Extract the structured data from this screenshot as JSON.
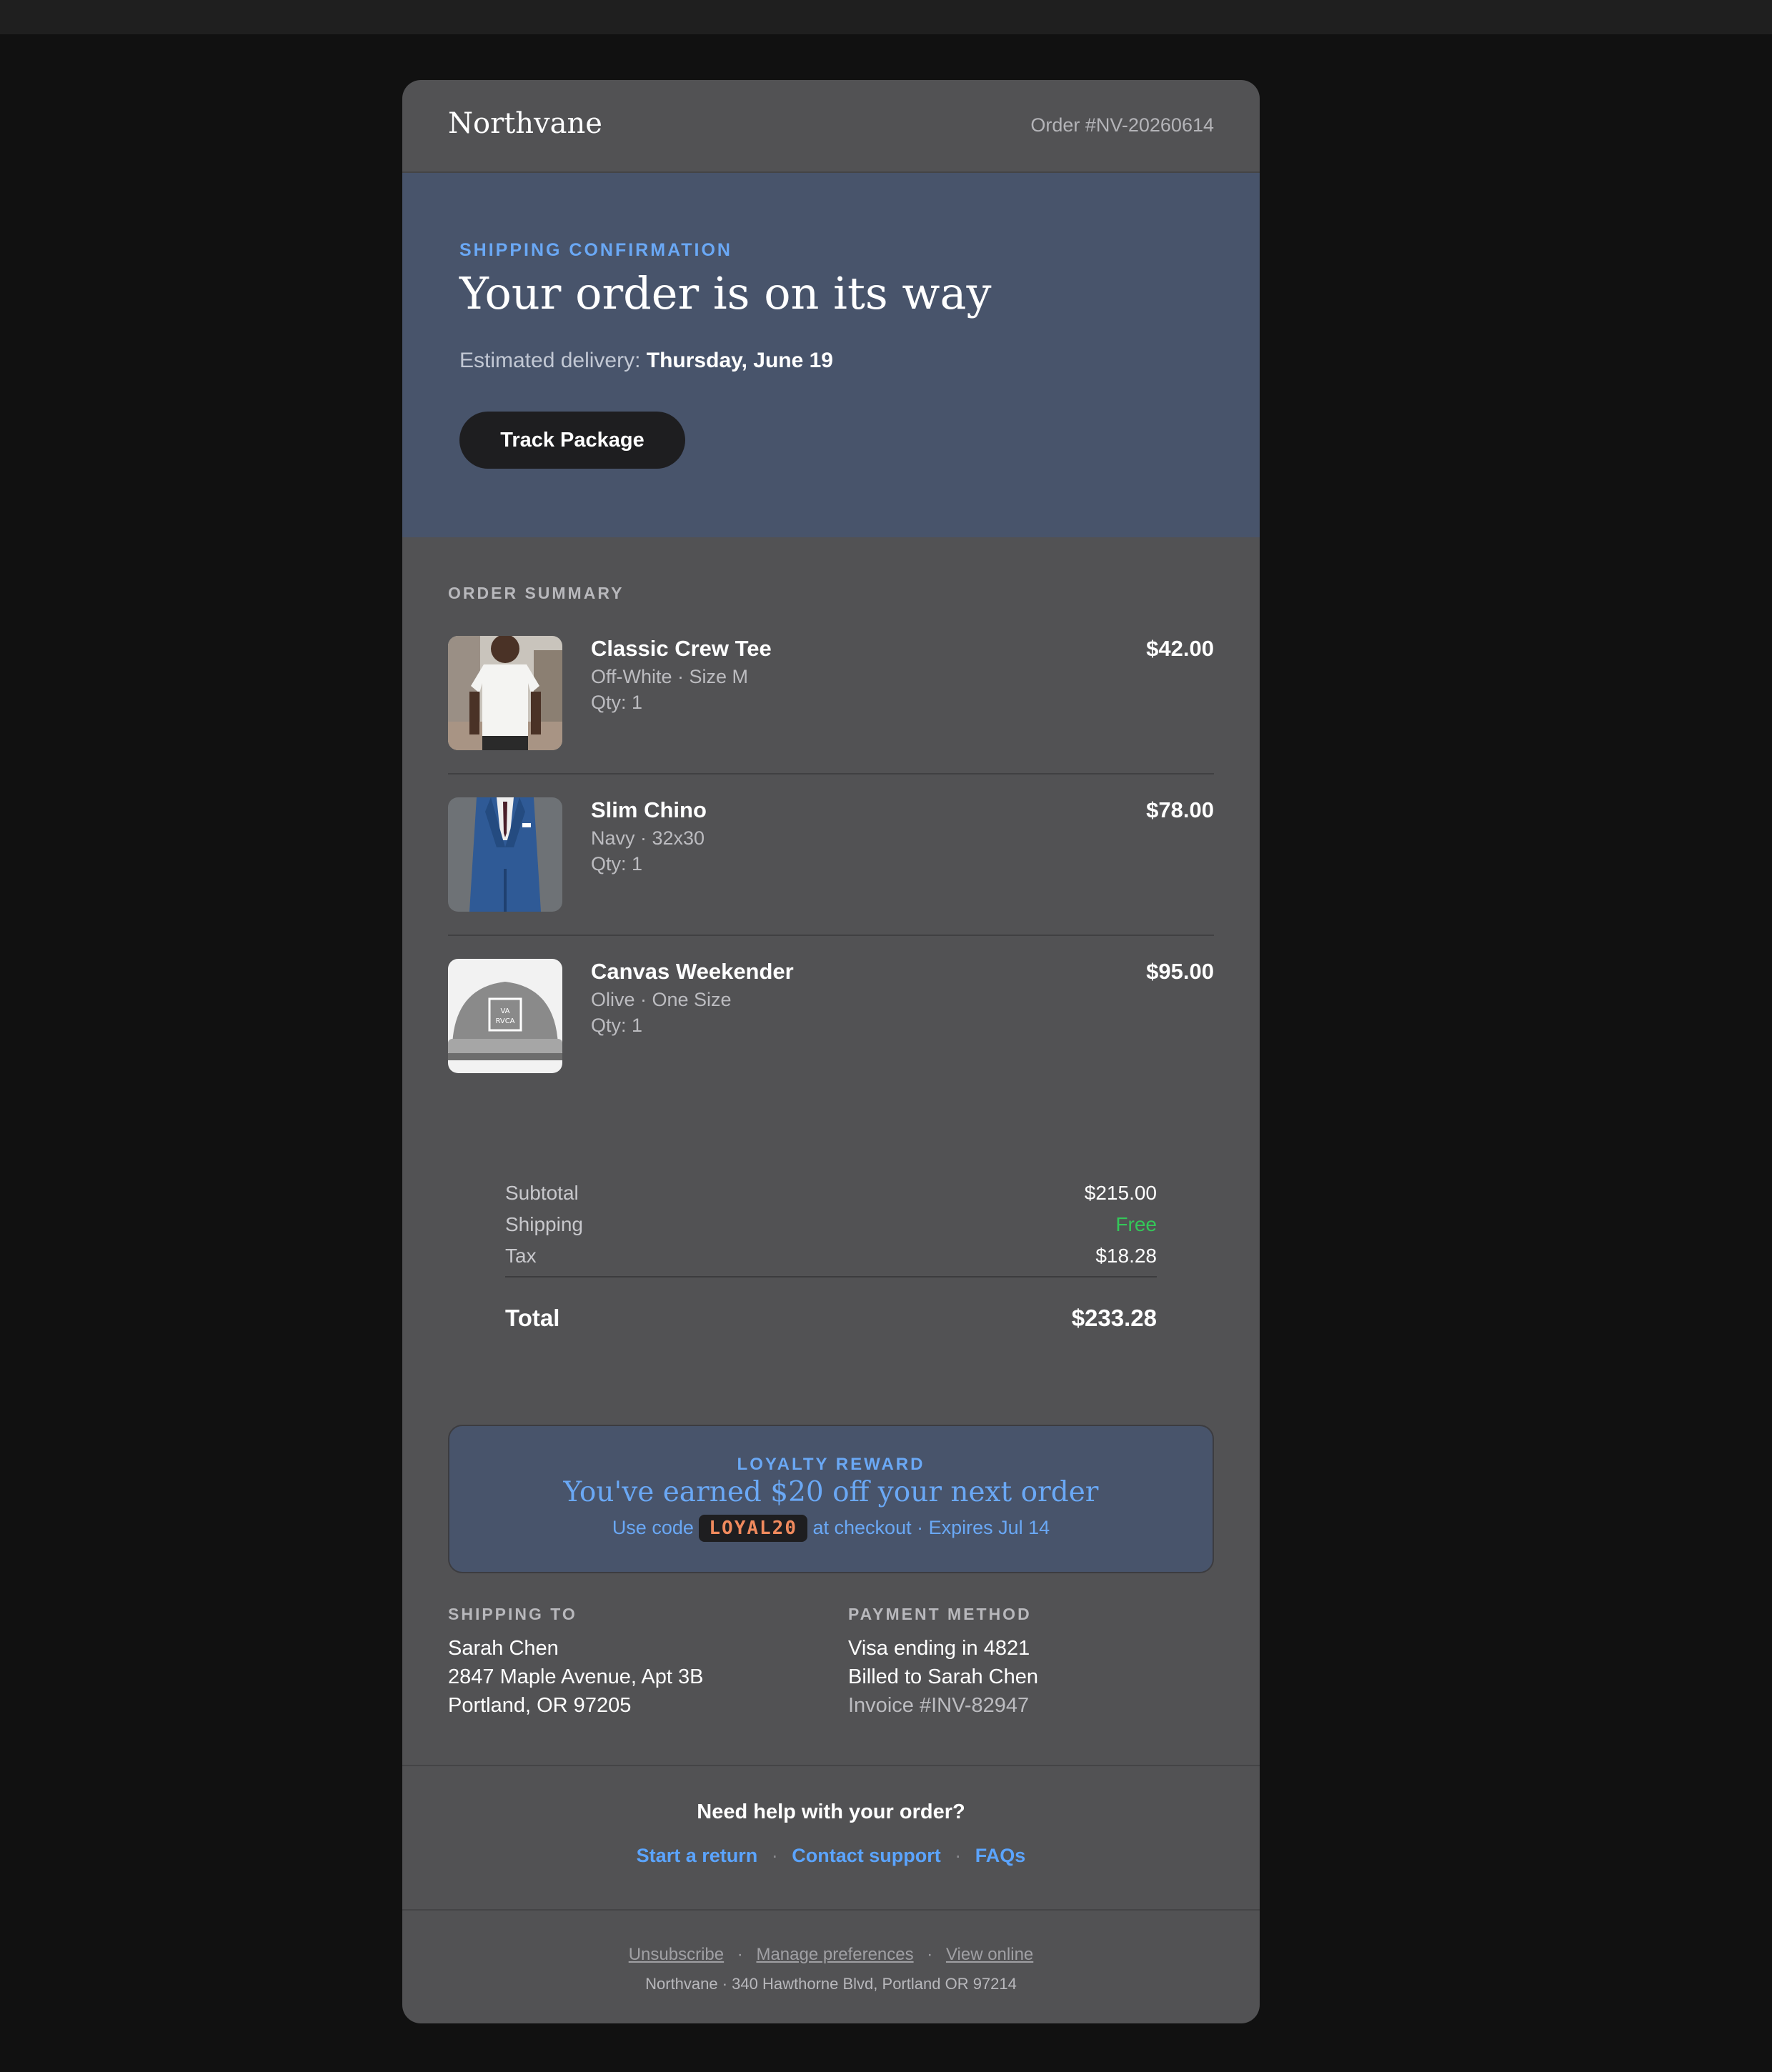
{
  "header": {
    "brand": "Northvane",
    "order_number": "Order #NV-20260614"
  },
  "hero": {
    "eyebrow": "SHIPPING CONFIRMATION",
    "title": "Your order is on its way",
    "estimated_label": "Estimated delivery:",
    "estimated_date": "Thursday, June 19",
    "track_button": "Track Package"
  },
  "summary": {
    "label": "ORDER SUMMARY",
    "items": [
      {
        "name": "Classic Crew Tee",
        "variant": "Off-White · Size M",
        "qty": "Qty: 1",
        "price": "$42.00",
        "image": "white-tshirt-photo"
      },
      {
        "name": "Slim Chino",
        "variant": "Navy · 32x30",
        "qty": "Qty: 1",
        "price": "$78.00",
        "image": "navy-suit-photo"
      },
      {
        "name": "Canvas Weekender",
        "variant": "Olive · One Size",
        "qty": "Qty: 1",
        "price": "$95.00",
        "image": "grey-cap-photo"
      }
    ]
  },
  "totals": {
    "subtotal_label": "Subtotal",
    "subtotal": "$215.00",
    "shipping_label": "Shipping",
    "shipping": "Free",
    "tax_label": "Tax",
    "tax": "$18.28",
    "total_label": "Total",
    "total": "$233.28"
  },
  "loyalty": {
    "eyebrow": "LOYALTY REWARD",
    "headline": "You've earned $20 off your next order",
    "use_code_prefix": "Use code",
    "code": "LOYAL20",
    "use_code_suffix": "at checkout · Expires Jul 14"
  },
  "shipping_to": {
    "label": "SHIPPING TO",
    "name": "Sarah Chen",
    "street": "2847 Maple Avenue, Apt 3B",
    "city": "Portland, OR 97205"
  },
  "payment": {
    "label": "PAYMENT METHOD",
    "card": "Visa ending in 4821",
    "billed": "Billed to Sarah Chen",
    "invoice": "Invoice #INV-82947"
  },
  "help": {
    "question": "Need help with your order?",
    "links": [
      "Start a return",
      "Contact support",
      "FAQs"
    ]
  },
  "footer": {
    "links": [
      "Unsubscribe",
      "Manage preferences",
      "View online"
    ],
    "address": "Northvane · 340 Hawthorne Blvd, Portland OR 97214"
  },
  "colors": {
    "page_background": "#111111",
    "card_background": "#525254",
    "hero_background": "#48546b",
    "accent_blue": "#6aa8f5",
    "link_blue": "#5ba4ff",
    "free_green": "#34c759",
    "code_orange": "#f08a5d"
  }
}
